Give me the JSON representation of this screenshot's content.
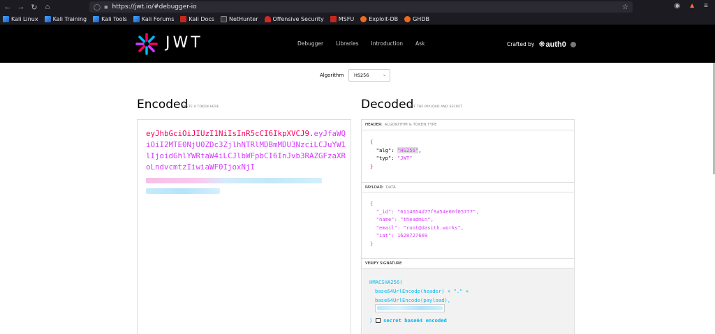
{
  "browser": {
    "url": "https://jwt.io/#debugger-io",
    "bookmarks": [
      {
        "label": "Kali Linux",
        "icon": "kali"
      },
      {
        "label": "Kali Training",
        "icon": "kali"
      },
      {
        "label": "Kali Tools",
        "icon": "kali"
      },
      {
        "label": "Kali Forums",
        "icon": "kali"
      },
      {
        "label": "Kali Docs",
        "icon": "red"
      },
      {
        "label": "NetHunter",
        "icon": "nh"
      },
      {
        "label": "Offensive Security",
        "icon": "os"
      },
      {
        "label": "MSFU",
        "icon": "red"
      },
      {
        "label": "Exploit-DB",
        "icon": "orange"
      },
      {
        "label": "GHDB",
        "icon": "orange"
      }
    ]
  },
  "jwt_header": {
    "logo_text": "JWT",
    "nav": [
      "Debugger",
      "Libraries",
      "Introduction",
      "Ask"
    ],
    "crafted_by": "Crafted by",
    "brand": "auth0"
  },
  "algorithm": {
    "label": "Algorithm",
    "value": "HS256"
  },
  "encoded": {
    "title": "Encoded",
    "subtitle": "PASTE A TOKEN HERE",
    "token_header": "eyJhbGciOiJIUzI1NiIsInR5cCI6IkpXVCJ9",
    "token_dot": ".",
    "token_payload_visible": "eyJfaWQiOiI2MTE0NjU0ZDc3ZjlhNTRlMDBmMDU3NzciLCJuYW1lIjoidGhlYWRtaW4iLCJlbWFpbCI6InJvb3RAZGFzaXRoLndvcmtzIiwiaWF0IjoxNjI"
  },
  "decoded": {
    "title": "Decoded",
    "subtitle": "EDIT THE PAYLOAD AND SECRET",
    "header_section": {
      "label": "HEADER:",
      "sublabel": "ALGORITHM & TOKEN TYPE"
    },
    "header_json": {
      "alg_key": "\"alg\"",
      "alg_value": "\"HS256\"",
      "typ_key": "\"typ\"",
      "typ_value": "\"JWT\""
    },
    "payload_section": {
      "label": "PAYLOAD:",
      "sublabel": "DATA"
    },
    "payload_json": {
      "id_key": "\"_id\"",
      "id_value": "\"6114654d77f9a54e00f05777\"",
      "name_key": "\"name\"",
      "name_value": "\"theadmin\"",
      "email_key": "\"email\"",
      "email_value": "\"root@dasith.works\"",
      "iat_key": "\"iat\"",
      "iat_value": "1628727669"
    },
    "signature_section": {
      "label": "VERIFY SIGNATURE"
    },
    "signature": {
      "fn": "HMACSHA256(",
      "line1": "base64UrlEncode(header) + \".\" +",
      "line2": "base64UrlEncode(payload),",
      "close": ")",
      "checkbox_label": "secret base64 encoded"
    }
  }
}
